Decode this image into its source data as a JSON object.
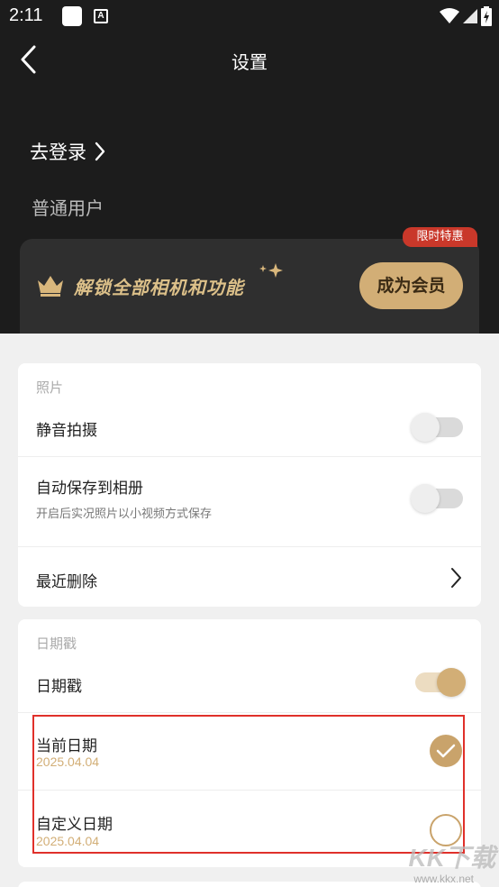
{
  "status_bar": {
    "time": "2:11",
    "notif_letter": "A"
  },
  "nav": {
    "title": "设置"
  },
  "account": {
    "login_label": "去登录",
    "user_type": "普通用户"
  },
  "vip": {
    "text": "解锁全部相机和功能",
    "button": "成为会员",
    "tag": "限时特惠"
  },
  "photo_section": {
    "title": "照片",
    "silent_shoot": "静音拍摄",
    "auto_save": "自动保存到相册",
    "auto_save_desc": "开启后实况照片以小视频方式保存",
    "recently_deleted": "最近删除"
  },
  "date_section": {
    "title": "日期戳",
    "date_stamp": "日期戳",
    "current_date": "当前日期",
    "current_date_value": "2025.04.04",
    "custom_date": "自定义日期",
    "custom_date_value": "2025.04.04"
  },
  "watermark": {
    "main": "KK下载",
    "url": "www.kkx.net"
  },
  "colors": {
    "accent": "#d2ae76",
    "dark_bg": "#1c1c1c",
    "tag_red": "#c9382a",
    "highlight_red": "#e0302a"
  }
}
